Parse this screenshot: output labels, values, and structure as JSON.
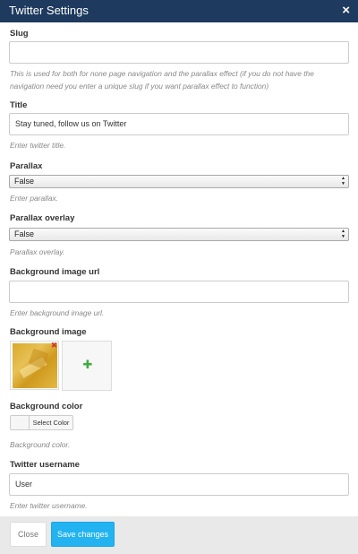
{
  "dialog": {
    "title": "Twitter Settings",
    "close_glyph": "×"
  },
  "fields": {
    "slug": {
      "label": "Slug",
      "value": "",
      "help": "This is used for both for none page navigation and the parallax effect (if you do not have the navigation need you enter a unique slug if you want parallax effect to function)"
    },
    "title": {
      "label": "Title",
      "value": "Stay tuned, follow us on Twitter",
      "help": "Enter twitter title."
    },
    "parallax": {
      "label": "Parallax",
      "selected": "False",
      "help": "Enter parallax."
    },
    "parallax_overlay": {
      "label": "Parallax overlay",
      "selected": "False",
      "help": "Parallax overlay."
    },
    "background_image_url": {
      "label": "Background image url",
      "value": "",
      "help": "Enter background image url."
    },
    "background_image": {
      "label": "Background image",
      "remove_icon": "close-icon",
      "add_icon": "plus-icon"
    },
    "background_color": {
      "label": "Background color",
      "button_label": "Select Color",
      "help": "Background color."
    },
    "twitter_username": {
      "label": "Twitter username",
      "value": "User",
      "help": "Enter twitter username."
    }
  },
  "footer": {
    "close_label": "Close",
    "save_label": "Save changes"
  },
  "colors": {
    "header_bg": "#1e3a5f",
    "primary_button": "#22b3f0",
    "footer_bg": "#e9e9e9"
  }
}
